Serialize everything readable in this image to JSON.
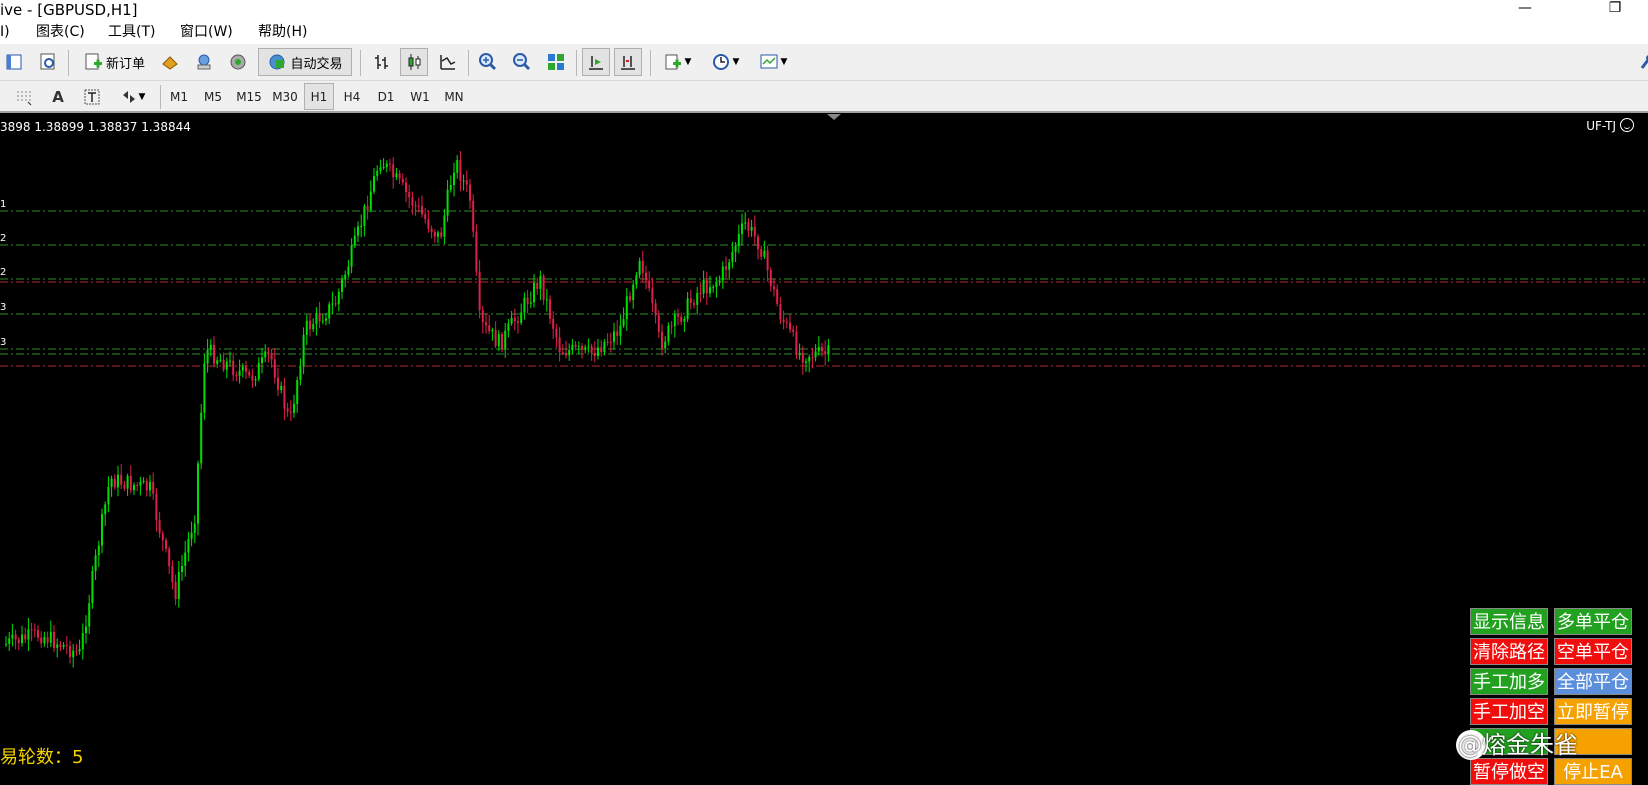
{
  "window": {
    "title": "ive - [GBPUSD,H1]",
    "minimize": "—",
    "restore": "❐"
  },
  "menu": {
    "items": [
      "I)",
      "图表(C)",
      "工具(T)",
      "窗口(W)",
      "帮助(H)"
    ]
  },
  "toolbar": {
    "new_order": "新订单",
    "auto_trade": "自动交易"
  },
  "timeframes": {
    "items": [
      "M1",
      "M5",
      "M15",
      "M30",
      "H1",
      "H4",
      "D1",
      "W1",
      "MN"
    ],
    "selected": "H1"
  },
  "chart": {
    "quote": "3898 1.38899 1.38837 1.38844",
    "ea_name": "UF-TJ",
    "level_labels": [
      "1",
      "2",
      "2",
      "3",
      "3"
    ],
    "rounds_label": "易轮数：5",
    "colors": {
      "bull": "#00e000",
      "bear": "#e0204a",
      "grid_green": "#2e8b2e",
      "grid_red": "#b52a2a"
    }
  },
  "panel": {
    "left": [
      "显示信息",
      "清除路径",
      "手工加多",
      "手工加空",
      "",
      "暂停做空"
    ],
    "right": [
      "多单平仓",
      "空单平仓",
      "全部平仓",
      "立即暂停",
      "",
      "停止EA"
    ]
  },
  "watermark": "@熔金朱雀"
}
